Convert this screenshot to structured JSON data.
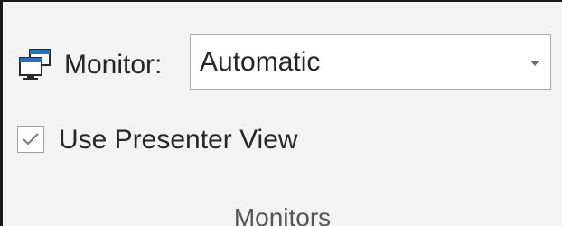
{
  "monitor": {
    "icon": "monitor-icon",
    "label": "Monitor:",
    "selected_value": "Automatic",
    "dropdown_icon": "chevron-down-icon"
  },
  "presenter_view": {
    "label": "Use Presenter View",
    "checked": true
  },
  "group": {
    "label": "Monitors"
  },
  "colors": {
    "background": "#f3f3f3",
    "text": "#262626",
    "group_label": "#555555",
    "icon_blue": "#2b6fb6",
    "border": "#ababab"
  }
}
